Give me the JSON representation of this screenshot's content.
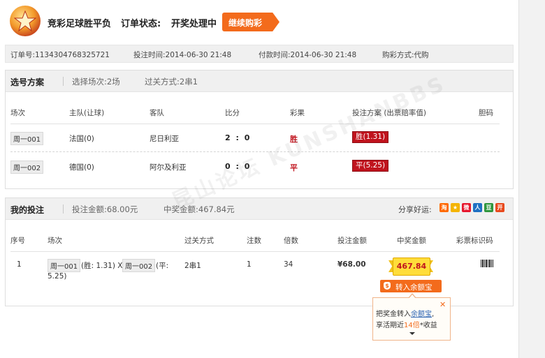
{
  "header": {
    "title": "竞彩足球胜平负",
    "status_label": "订单状态:",
    "status_value": "开奖处理中",
    "continue_button": "继续购彩"
  },
  "order": {
    "order_no": "订单号:1134304768325721",
    "bet_time": "投注时间:2014-06-30 21:48",
    "pay_time": "付款时间:2014-06-30 21:48",
    "buy_method": "购彩方式:代购"
  },
  "selection": {
    "heading": "选号方案",
    "matches_selected": "选择场次:2场",
    "pass_type": "过关方式:2串1",
    "columns": [
      "场次",
      "主队(让球)",
      "客队",
      "比分",
      "彩果",
      "投注方案 (出票赔率值)",
      "胆码"
    ],
    "rows": [
      {
        "match": "周一001",
        "home": "法国(0)",
        "away": "尼日利亚",
        "score": "2 : 0",
        "result": "胜",
        "bet": "胜(1.31)"
      },
      {
        "match": "周一002",
        "home": "德国(0)",
        "away": "阿尔及利亚",
        "score": "0 : 0",
        "result": "平",
        "bet": "平(5.25)"
      }
    ]
  },
  "my_bets": {
    "heading": "我的投注",
    "bet_amount": "投注金额:68.00元",
    "win_amount": "中奖金额:467.84元",
    "share_label": "分享好运:",
    "share_icons": [
      {
        "name": "taobao-icon",
        "glyph": "淘",
        "color": "#ff6a00"
      },
      {
        "name": "qzone-icon",
        "glyph": "★",
        "color": "#f4b400"
      },
      {
        "name": "weibo-icon",
        "glyph": "微",
        "color": "#e6162d"
      },
      {
        "name": "renren-icon",
        "glyph": "人",
        "color": "#1e70c2"
      },
      {
        "name": "douban-icon",
        "glyph": "豆",
        "color": "#2e963d"
      },
      {
        "name": "kaixin-icon",
        "glyph": "开",
        "color": "#e8491c"
      }
    ],
    "columns": [
      "序号",
      "场次",
      "过关方式",
      "注数",
      "倍数",
      "投注金额",
      "中奖金额",
      "彩票标识码"
    ],
    "row": {
      "index": "1",
      "match1": "周一001",
      "pick1": "(胜: 1.31) X",
      "match2": "周一002",
      "pick2": "(平:",
      "pick2_cont": "5.25)",
      "pass_type": "2串1",
      "count": "1",
      "multiple": "34",
      "amount": "¥68.00",
      "prize": "467.84"
    },
    "transfer_button": "转入余额宝",
    "tooltip": {
      "line1_pre": "把奖金转入",
      "line1_link": "余额宝",
      "line1_post": ",",
      "line2_pre": "享活期近",
      "line2_highlight": "14倍",
      "line2_post": "*收益",
      "close": "✕"
    }
  },
  "watermark": "昆山论坛 KUNSHANBBS"
}
